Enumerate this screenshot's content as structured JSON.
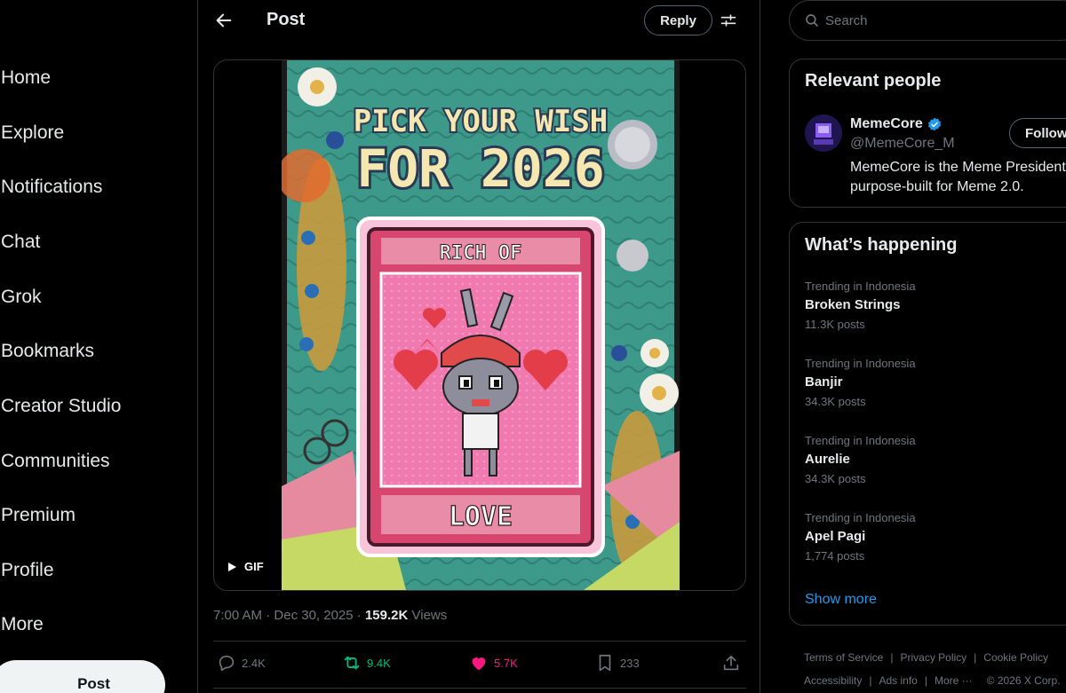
{
  "nav": {
    "items": [
      "Home",
      "Explore",
      "Notifications",
      "Chat",
      "Grok",
      "Bookmarks",
      "Creator Studio",
      "Communities",
      "Premium",
      "Profile",
      "More"
    ],
    "post_button": "Post"
  },
  "header": {
    "title": "Post",
    "reply_label": "Reply"
  },
  "media": {
    "badge": "GIF",
    "art": {
      "headline_line1": "PICK YOUR WISH",
      "headline_line2": "FOR 2026",
      "card_top": "RICH OF",
      "card_bottom": "LOVE"
    }
  },
  "meta": {
    "time": "7:00 AM",
    "separator": " · ",
    "date": "Dec 30, 2025",
    "views_count": "159.2K",
    "views_label": "Views"
  },
  "actions": {
    "replies": "2.4K",
    "reposts": "9.4K",
    "likes": "5.7K",
    "bookmarks": "233"
  },
  "colors": {
    "repost_green": "#00ba7c",
    "like_pink": "#f91880",
    "link_blue": "#1d9bf0",
    "verified_blue": "#1d9bf0"
  },
  "search": {
    "placeholder": "Search"
  },
  "relevant": {
    "title": "Relevant people",
    "name": "MemeCore",
    "handle": "@MemeCore_M",
    "follow_label": "Follow",
    "bio": "MemeCore is the Meme President purpose-built for Meme 2.0."
  },
  "trending": {
    "title": "What’s happening",
    "items": [
      {
        "context": "Trending in Indonesia",
        "name": "Broken Strings",
        "count": "11.3K posts"
      },
      {
        "context": "Trending in Indonesia",
        "name": "Banjir",
        "count": "34.3K posts"
      },
      {
        "context": "Trending in Indonesia",
        "name": "Aurelie",
        "count": "34.3K posts"
      },
      {
        "context": "Trending in Indonesia",
        "name": "Apel Pagi",
        "count": "1,774 posts"
      }
    ],
    "show_more": "Show more"
  },
  "footer": {
    "terms": "Terms of Service",
    "privacy": "Privacy Policy",
    "cookie": "Cookie Policy",
    "accessibility": "Accessibility",
    "ads": "Ads info",
    "more": "More ···",
    "copyright": "© 2026 X Corp."
  }
}
